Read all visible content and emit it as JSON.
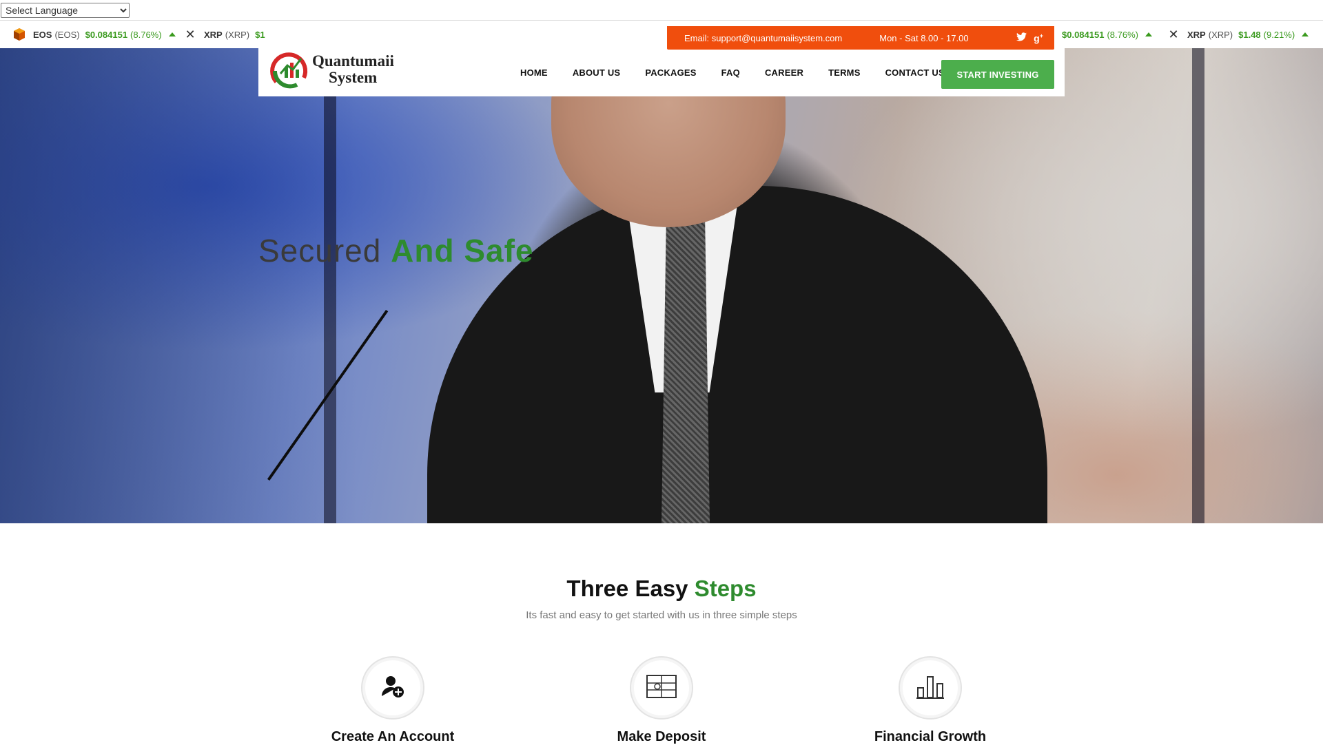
{
  "language": {
    "selected": "Select Language"
  },
  "ticker": [
    {
      "name": "EOS",
      "symbol": "(EOS)",
      "price": "$0.084151",
      "change": "(8.76%)",
      "icon": "eos-icon"
    },
    {
      "name": "XRP",
      "symbol": "(XRP)",
      "price": "$1",
      "change": "",
      "icon": "xrp-icon"
    },
    {
      "name": "",
      "symbol": "",
      "price": "$0.084151",
      "change": "(8.76%)",
      "icon": ""
    },
    {
      "name": "XRP",
      "symbol": "(XRP)",
      "price": "$1.48",
      "change": "(9.21%)",
      "icon": "xrp-icon"
    }
  ],
  "contact": {
    "email": "Email: support@quantumaiisystem.com",
    "hours": "Mon - Sat 8.00 - 17.00",
    "social": [
      "twitter-icon",
      "google-plus-icon"
    ]
  },
  "logo": {
    "line1": "Quantumaii",
    "line2": "System"
  },
  "nav": {
    "items": [
      "HOME",
      "ABOUT US",
      "PACKAGES",
      "FAQ",
      "CAREER",
      "TERMS",
      "CONTACT US"
    ],
    "cta": "START INVESTING"
  },
  "hero": {
    "title_plain": "Secured",
    "title_accent": "And Safe"
  },
  "steps": {
    "title_plain": "Three Easy",
    "title_accent": "Steps",
    "subtitle": "Its fast and easy to get started with us in three simple steps",
    "items": [
      {
        "label": "Create An Account",
        "icon": "add-user-icon"
      },
      {
        "label": "Make Deposit",
        "icon": "deposit-icon"
      },
      {
        "label": "Financial Growth",
        "icon": "bar-chart-icon"
      }
    ]
  },
  "colors": {
    "accent_green": "#2e8b2e",
    "button_green": "#4cae4c",
    "contact_orange": "#f04e0d",
    "ticker_green": "#3a9a1e"
  }
}
